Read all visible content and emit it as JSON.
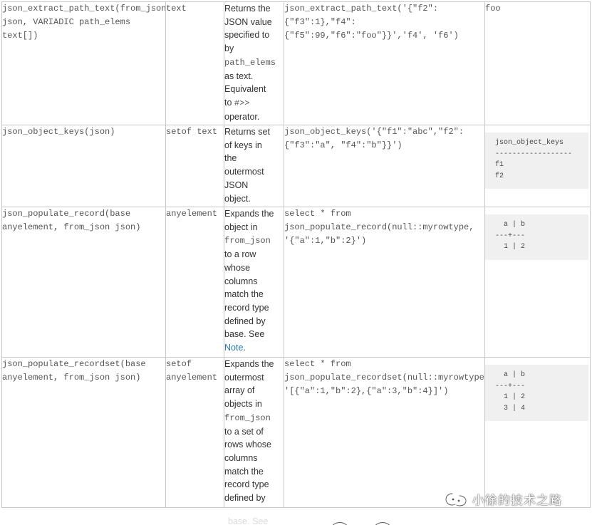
{
  "rows": [
    {
      "function": [
        "json_extract_path_text(from_json",
        "json, VARIADIC path_elems",
        "text[])"
      ],
      "return_type": [
        "text"
      ],
      "description": [
        {
          "t": "Returns the"
        },
        {
          "t": "JSON value"
        },
        {
          "t": "specified to"
        },
        {
          "t": "by"
        },
        {
          "code": "path_elems"
        },
        {
          "t": "as text."
        },
        {
          "t": "Equivalent"
        },
        {
          "t": "to ",
          "code": "#>>"
        },
        {
          "t": "operator."
        }
      ],
      "example": [
        "json_extract_path_text('{\"f2\":",
        "{\"f3\":1},\"f4\":",
        "{\"f5\":99,\"f6\":\"foo\"}}','f4', 'f6')"
      ],
      "result": {
        "text": "foo"
      }
    },
    {
      "function": [
        "json_object_keys(json)"
      ],
      "return_type": [
        "setof text"
      ],
      "description": [
        {
          "t": "Returns set"
        },
        {
          "t": "of keys in"
        },
        {
          "t": "the"
        },
        {
          "t": "outermost"
        },
        {
          "t": "JSON"
        },
        {
          "t": "object."
        }
      ],
      "example": [
        "json_object_keys('{\"f1\":\"abc\",\"f2\":",
        "{\"f3\":\"a\", \"f4\":\"b\"}}')"
      ],
      "result": {
        "block": [
          "json_object_keys",
          "------------------",
          "f1",
          "f2"
        ]
      }
    },
    {
      "function": [
        "json_populate_record(base",
        "anyelement, from_json json)"
      ],
      "return_type": [
        "anyelement"
      ],
      "description": [
        {
          "t": "Expands the"
        },
        {
          "t": "object in"
        },
        {
          "code": "from_json"
        },
        {
          "t": "to a row"
        },
        {
          "t": "whose"
        },
        {
          "t": "columns"
        },
        {
          "t": "match the"
        },
        {
          "t": "record type"
        },
        {
          "t": "defined by"
        },
        {
          "t": "base. See"
        },
        {
          "link": "Note",
          "after": "."
        }
      ],
      "example": [
        "select * from",
        "json_populate_record(null::myrowtype,",
        "'{\"a\":1,\"b\":2}')"
      ],
      "result": {
        "block": [
          "  a | b",
          "---+---",
          "  1 | 2"
        ]
      }
    },
    {
      "function": [
        "json_populate_recordset(base",
        "anyelement, from_json json)"
      ],
      "return_type": [
        "setof",
        "anyelement"
      ],
      "description": [
        {
          "t": "Expands the"
        },
        {
          "t": "outermost"
        },
        {
          "t": "array of"
        },
        {
          "t": "objects in"
        },
        {
          "code": "from_json"
        },
        {
          "t": "to a set of"
        },
        {
          "t": "rows whose"
        },
        {
          "t": "columns"
        },
        {
          "t": "match the"
        },
        {
          "t": "record type"
        },
        {
          "t": "defined by"
        }
      ],
      "example": [
        "select * from",
        "json_populate_recordset(null::myrowtype,",
        "'[{\"a\":1,\"b\":2},{\"a\":3,\"b\":4}]')"
      ],
      "result": {
        "block": [
          "  a | b",
          "---+---",
          "  1 | 2",
          "  3 | 4"
        ]
      }
    }
  ],
  "cutoff_text": "base. See",
  "watermark": {
    "text": "小徐的技术之路",
    "icon": "wechat-official-account-icon"
  },
  "colors": {
    "border": "#c8c8c8",
    "result_bg": "#f0f0f0",
    "link": "#2a7ab0",
    "text": "#333333"
  }
}
